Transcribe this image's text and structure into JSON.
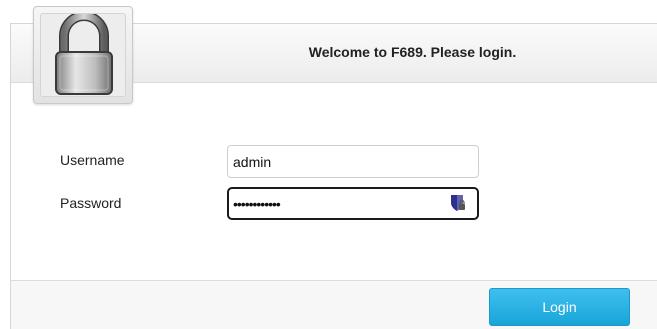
{
  "header": {
    "title": "Welcome to F689. Please login."
  },
  "icons": {
    "lock": "padlock-icon",
    "password_manager": "password-manager-icon"
  },
  "form": {
    "username_label": "Username",
    "username_value": "admin",
    "password_label": "Password",
    "password_value": "••••••••••••"
  },
  "footer": {
    "login_label": "Login"
  },
  "colors": {
    "login_button": "#18a4d9",
    "password_icon": "#2b2f8f"
  }
}
